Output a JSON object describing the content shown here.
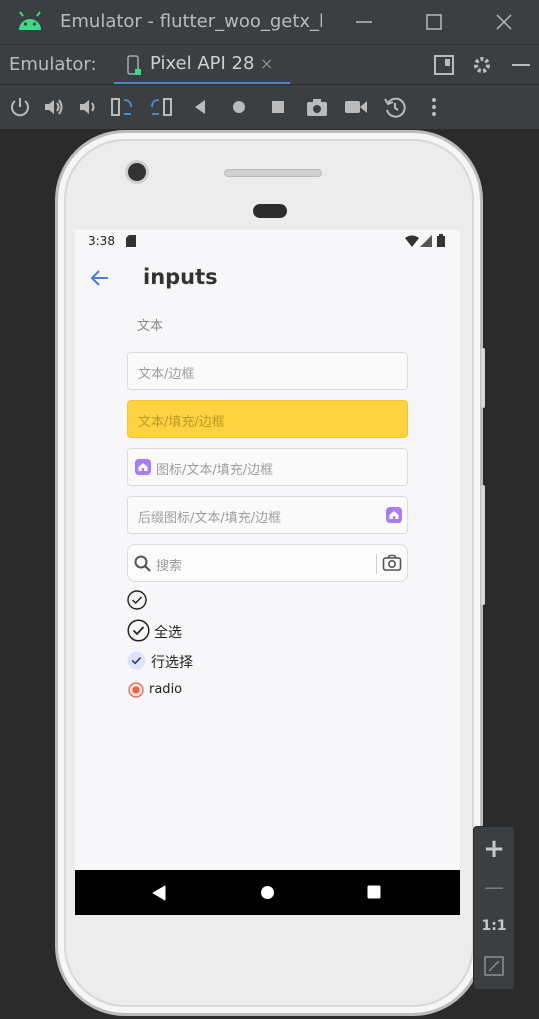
{
  "window": {
    "title": "Emulator - flutter_woo_getx_learn",
    "minimize_glyph": "—",
    "maximize_glyph": "☐",
    "close_glyph": "✕"
  },
  "tabbar": {
    "emulator_label": "Emulator:",
    "tab_label": "Pixel API 28",
    "tab_close": "×"
  },
  "toolbar": {
    "icons": [
      "power-icon",
      "volume-up-icon",
      "volume-down-icon",
      "rotate-left-icon",
      "rotate-right-icon",
      "back-icon",
      "home-icon",
      "overview-icon",
      "screenshot-icon",
      "screen-record-icon",
      "snapshot-icon",
      "more-icon"
    ]
  },
  "status_bar": {
    "time": "3:38"
  },
  "app_bar": {
    "title": "inputs"
  },
  "inputs": {
    "plain_text_label": "文本",
    "bordered_placeholder": "文本/边框",
    "filled_placeholder": "文本/填充/边框",
    "icon_filled_placeholder": "图标/文本/填充/边框",
    "suffix_icon_placeholder": "后缀图标/文本/填充/边框",
    "search_placeholder": "搜索"
  },
  "checks": {
    "select_all_label": "全选",
    "row_select_label": "行选择",
    "radio_label": "radio"
  },
  "zoom_panel": {
    "zoom_in": "+",
    "zoom_out": "—",
    "actual_size": "1:1"
  },
  "colors": {
    "accent": "#4a88c7",
    "fill_yellow": "#ffd23f",
    "badge_purple": "#a97cf8",
    "radio_red": "#e85d4a"
  }
}
